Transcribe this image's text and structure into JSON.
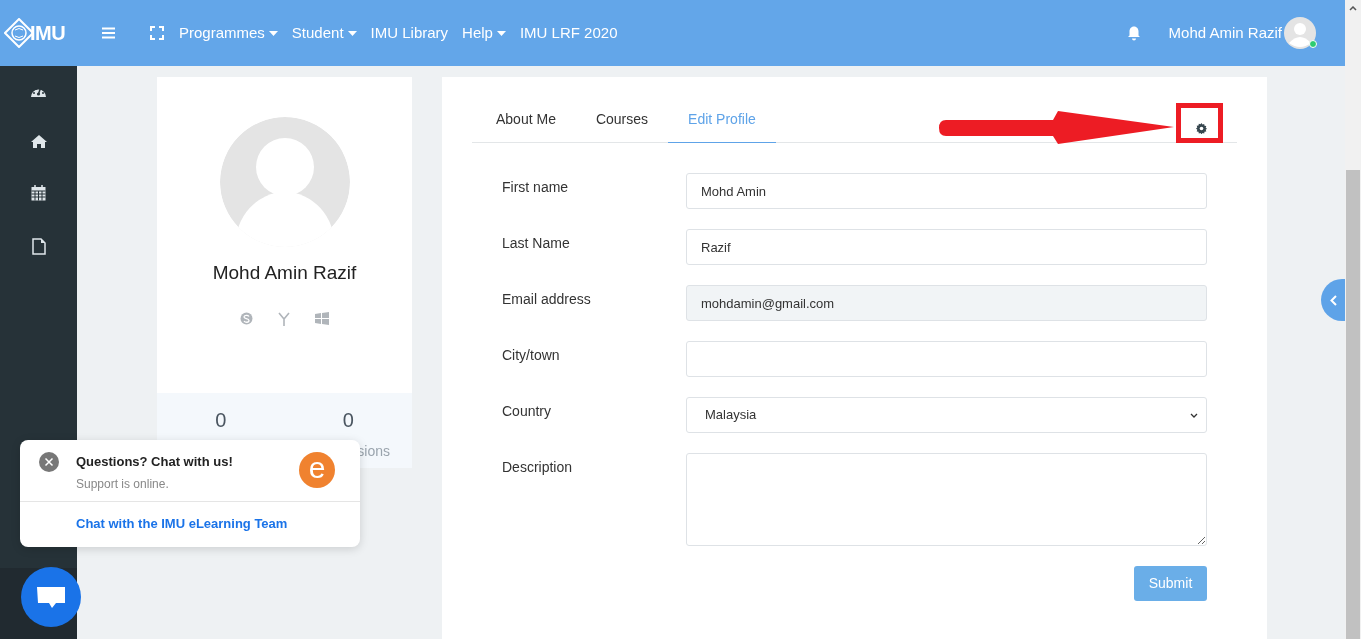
{
  "topbar": {
    "logo": "IMU",
    "nav": [
      {
        "label": "Programmes",
        "dropdown": true
      },
      {
        "label": "Student",
        "dropdown": true
      },
      {
        "label": "IMU Library",
        "dropdown": false
      },
      {
        "label": "Help",
        "dropdown": true
      },
      {
        "label": "IMU LRF 2020",
        "dropdown": false
      }
    ],
    "user_name": "Mohd Amin Razif",
    "online": true
  },
  "profile": {
    "name": "Mohd Amin Razif",
    "stats": [
      {
        "value": "0"
      },
      {
        "value": "0",
        "label": "sions"
      }
    ]
  },
  "tabs": [
    {
      "label": "About Me",
      "selected": false
    },
    {
      "label": "Courses",
      "selected": false
    },
    {
      "label": "Edit Profile",
      "selected": true
    }
  ],
  "form": {
    "fields": [
      {
        "label": "First name",
        "kind": "text",
        "value": "Mohd Amin",
        "disabled": false
      },
      {
        "label": "Last Name",
        "kind": "text",
        "value": "Razif",
        "disabled": false
      },
      {
        "label": "Email address",
        "kind": "text",
        "value": "mohdamin@gmail.com",
        "disabled": true
      },
      {
        "label": "City/town",
        "kind": "text",
        "disabled": false
      },
      {
        "label": "Country",
        "kind": "select",
        "value": "Malaysia"
      },
      {
        "label": "Description",
        "kind": "textarea"
      }
    ],
    "submit": "Submit"
  },
  "chat": {
    "title": "Questions? Chat with us!",
    "status": "Support is online.",
    "link": "Chat with the IMU eLearning Team",
    "badge": "e"
  }
}
